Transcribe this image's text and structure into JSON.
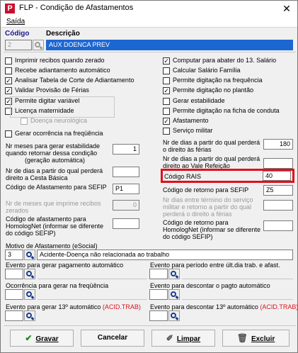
{
  "window": {
    "title": "FLP - Condição de Afastamentos",
    "close_glyph": "✕",
    "app_icon": "P"
  },
  "menu": {
    "exit_label": "Saída"
  },
  "header": {
    "code_label": "Código",
    "description_label": "Descrição",
    "code_value": "2",
    "description_value": "AUX DOENCA PREV"
  },
  "left_checks": [
    {
      "label": "Imprimir recibos quando zerado",
      "checked": false
    },
    {
      "label": "Recebe adiantamento automático",
      "checked": false
    },
    {
      "label": "Analisar Tabela de Corte de Adiantamento",
      "checked": true
    },
    {
      "label": "Validar Provisão de Férias",
      "checked": true
    },
    {
      "label": "Permite digitar variável",
      "checked": true
    },
    {
      "label": "Licença maternidade",
      "checked": false
    },
    {
      "label": "Doença neurológica",
      "checked": false,
      "disabled": true
    },
    {
      "label": "Gerar ocorrência na freqüência",
      "checked": false
    }
  ],
  "right_checks": [
    {
      "label": "Computar para abater do 13. Salário",
      "checked": true
    },
    {
      "label": "Calcular Salário Família",
      "checked": false
    },
    {
      "label": "Permite digitação na frequência",
      "checked": false
    },
    {
      "label": "Permite digitação no plantão",
      "checked": true
    },
    {
      "label": "Gerar estabilidade",
      "checked": false
    },
    {
      "label": "Permite digitação na ficha de conduta",
      "checked": false
    },
    {
      "label": "Afastamento",
      "checked": true
    },
    {
      "label": "Serviço militar",
      "checked": false
    }
  ],
  "left_fields": {
    "meses_estabilidade_label": "Nr meses para gerar estabilidade quando retornar dessa condição",
    "meses_estabilidade_sub": "(geração automática)",
    "meses_estabilidade_value": "1",
    "cesta_basica_label": "Nr de dias a partir do qual perderá direito a Cesta Básica",
    "cesta_basica_value": "",
    "sefip_label": "Código de Afastamento para SEFIP",
    "sefip_value": "P1",
    "meses_zerados_label": "Nr de meses que imprime recibos zerados",
    "meses_zerados_value": "0",
    "homolognet_label": "Código de afastamento para HomologNet (informar se diferente do código SEFIP)",
    "homolognet_value": ""
  },
  "right_fields": {
    "ferias_label": "Nr de dias a partir do qual perderá o direito às férias",
    "ferias_value": "180",
    "vale_refeicao_label": "Nr de dias a partir do qual perderá direito ao Vale Refeição",
    "vale_refeicao_value": "",
    "rais_label": "Código RAIS",
    "rais_value": "40",
    "retorno_sefip_label": "Código de retorno para SEFIP",
    "retorno_sefip_value": "Z5",
    "dias_militar_label": "Nr dias entre término do serviço militar e retorno a partir do qual perderá o direito a férias",
    "dias_militar_value": "",
    "retorno_homolognet_label": "Código de retorno para HomologNet (informar se diferente do código SEFIP)",
    "retorno_homolognet_value": ""
  },
  "esocial": {
    "label": "Motivo de Afastamento (eSocial)",
    "code": "3",
    "description": "Acidente-Doença não relacionada ao trabalho"
  },
  "events": {
    "pagamento_label": "Evento para gerar pagamento automático",
    "periodo_label": "Evento para período entre últ.dia trab. e afast.",
    "ocorrencia_label": "Ocorrência para gerar na freqüência",
    "descontar_label": "Evento para descontar o pagto automático",
    "decimo_label": "Evento para gerar 13º automático",
    "decimo_desc_label": "Evento para descontar 13º automático",
    "acid_trab": "(ACID.TRAB)"
  },
  "buttons": {
    "save": "Gravar",
    "cancel": "Cancelar",
    "clear": "Limpar",
    "delete": "Excluir"
  },
  "colors": {
    "highlight_border": "#e0101e",
    "selection": "#1c66d1",
    "accent_red": "#d9131e"
  }
}
